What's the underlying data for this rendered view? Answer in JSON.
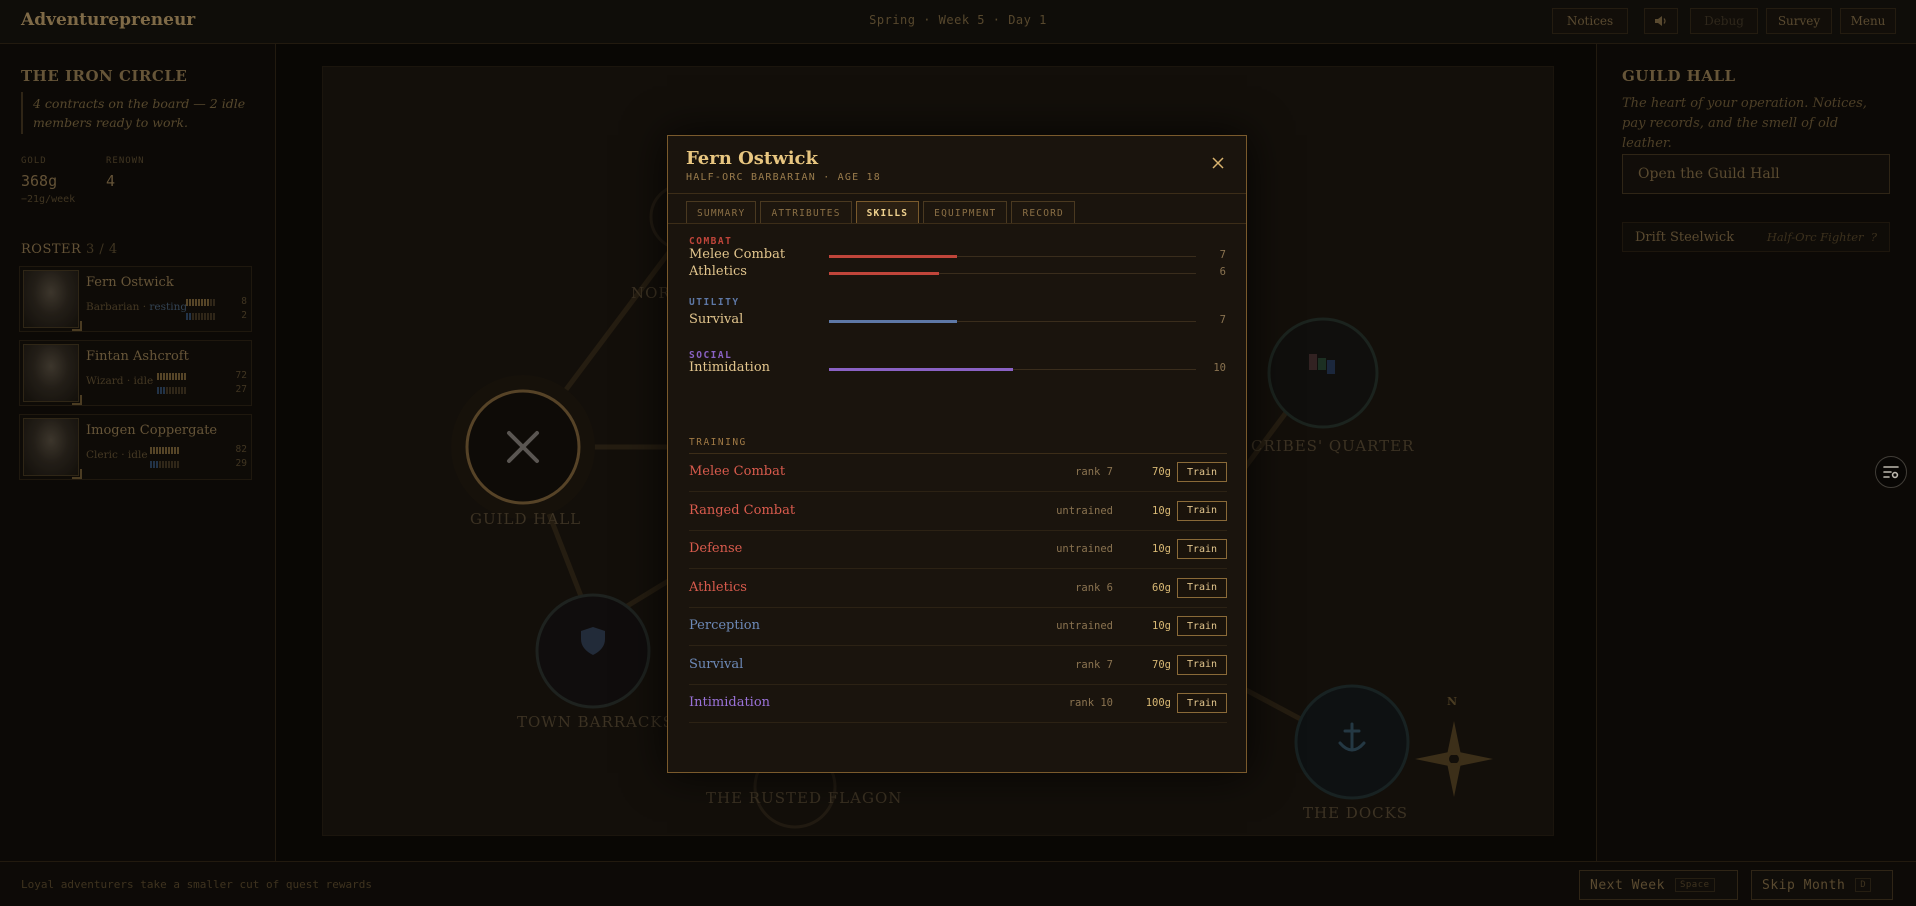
{
  "topbar": {
    "app_title": "Adventurepreneur",
    "date": "Spring · Week 5 · Day 1",
    "notices_label": "Notices",
    "sound_icon": "speaker-icon",
    "debug_label": "Debug",
    "survey_label": "Survey",
    "menu_label": "Menu"
  },
  "left": {
    "guild_name": "THE IRON CIRCLE",
    "notice": "4 contracts on the board — 2 idle members ready to work.",
    "gold_label": "GOLD",
    "gold_value": "368g",
    "gold_rate": "−21g/week",
    "renown_label": "RENOWN",
    "renown_value": "4",
    "roster_label": "ROSTER",
    "roster_count": "3 / 4",
    "roster": [
      {
        "name": "Fern Ostwick",
        "class": "Barbarian · ",
        "status": "resting",
        "top_value": "8",
        "bottom_value": "2"
      },
      {
        "name": "Fintan Ashcroft",
        "class": "Wizard · idle",
        "status": "",
        "top_value": "72",
        "bottom_value": "27"
      },
      {
        "name": "Imogen Coppergate",
        "class": "Cleric · idle",
        "status": "",
        "top_value": "82",
        "bottom_value": "29"
      }
    ]
  },
  "map": {
    "labels": {
      "guild_hall": "GUILD HALL",
      "north": "NOR",
      "scribes": "CRIBES' QUARTER",
      "barracks": "TOWN BARRACKS",
      "flagon": "THE RUSTED FLAGON",
      "docks": "THE DOCKS"
    },
    "compass_n": "N"
  },
  "right": {
    "title": "GUILD HALL",
    "description": "The heart of your operation. Notices, pay records, and the smell of old leather.",
    "open_button": "Open the Guild Hall",
    "member_name": "Drift Steelwick",
    "member_class": "Half-Orc Fighter",
    "member_mark": "?"
  },
  "bottom": {
    "tip": "Loyal adventurers take a smaller cut of quest rewards",
    "next_week": "Next Week",
    "next_week_key": "Space",
    "skip_month": "Skip Month",
    "skip_month_key": "D"
  },
  "modal": {
    "name": "Fern Ostwick",
    "subtitle": "HALF-ORC BARBARIAN · AGE 18",
    "tabs": [
      "SUMMARY",
      "ATTRIBUTES",
      "SKILLS",
      "EQUIPMENT",
      "RECORD"
    ],
    "active_tab": "SKILLS",
    "max_rank": 20,
    "categories": [
      {
        "label": "COMBAT",
        "color": "#c0453a",
        "skills": [
          {
            "name": "Melee Combat",
            "value": 7
          },
          {
            "name": "Athletics",
            "value": 6
          }
        ]
      },
      {
        "label": "UTILITY",
        "color": "#5e78a6",
        "skills": [
          {
            "name": "Survival",
            "value": 7
          }
        ]
      },
      {
        "label": "SOCIAL",
        "color": "#8a62c4",
        "skills": [
          {
            "name": "Intimidation",
            "value": 10
          }
        ]
      }
    ],
    "training_title": "TRAINING",
    "train_button": "Train",
    "training": [
      {
        "name": "Melee Combat",
        "rank": "rank 7",
        "cost": "70g",
        "color": "#d95b4d"
      },
      {
        "name": "Ranged Combat",
        "rank": "untrained",
        "cost": "10g",
        "color": "#d95b4d"
      },
      {
        "name": "Defense",
        "rank": "untrained",
        "cost": "10g",
        "color": "#d95b4d"
      },
      {
        "name": "Athletics",
        "rank": "rank 6",
        "cost": "60g",
        "color": "#d95b4d"
      },
      {
        "name": "Perception",
        "rank": "untrained",
        "cost": "10g",
        "color": "#6d8ab8"
      },
      {
        "name": "Survival",
        "rank": "rank 7",
        "cost": "70g",
        "color": "#6d8ab8"
      },
      {
        "name": "Intimidation",
        "rank": "rank 10",
        "cost": "100g",
        "color": "#9a72d8"
      }
    ]
  }
}
